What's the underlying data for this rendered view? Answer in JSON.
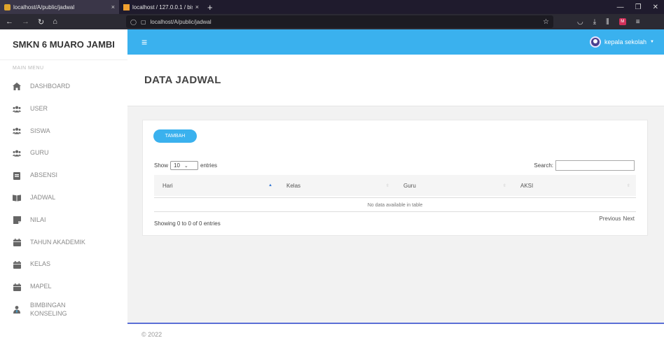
{
  "browser": {
    "tabs": [
      {
        "title": "localhost/A/public/jadwal",
        "close": "×"
      },
      {
        "title": "localhost / 127.0.0.1 / bismillah",
        "close": "×"
      }
    ],
    "new_tab": "+",
    "url": "localhost/A/public/jadwal"
  },
  "sidebar": {
    "brand": "SMKN 6 MUARO JAMBI",
    "menu_label": "MAIN MENU",
    "items": [
      {
        "label": "DASHBOARD",
        "icon": "home-icon"
      },
      {
        "label": "USER",
        "icon": "users-icon"
      },
      {
        "label": "SISWA",
        "icon": "users-icon"
      },
      {
        "label": "GURU",
        "icon": "users-icon"
      },
      {
        "label": "ABSENSI",
        "icon": "clipboard-icon"
      },
      {
        "label": "JADWAL",
        "icon": "book-icon"
      },
      {
        "label": "NILAI",
        "icon": "note-icon"
      },
      {
        "label": "TAHUN AKADEMIK",
        "icon": "calendar-icon"
      },
      {
        "label": "KELAS",
        "icon": "calendar-icon"
      },
      {
        "label": "MAPEL",
        "icon": "calendar-icon"
      },
      {
        "label": "BIMBINGAN KONSELING",
        "label_line1": "BIMBINGAN",
        "label_line2": "KONSELING",
        "icon": "user-tie-icon"
      }
    ]
  },
  "header": {
    "user_name": "kepala sekolah",
    "accent": "#3ab1ee"
  },
  "page": {
    "title": "DATA JADWAL"
  },
  "card": {
    "add_button": "TAMBAH",
    "show_label": "Show",
    "entries_value": "10",
    "entries_label": "entries",
    "search_label": "Search:",
    "columns": [
      "Hari",
      "Kelas",
      "Guru",
      "AKSI"
    ],
    "empty_text": "No data available in table",
    "info": "Showing 0 to 0 of 0 entries",
    "prev": "Previous",
    "next": "Next"
  },
  "footer": {
    "text": "© 2022"
  }
}
